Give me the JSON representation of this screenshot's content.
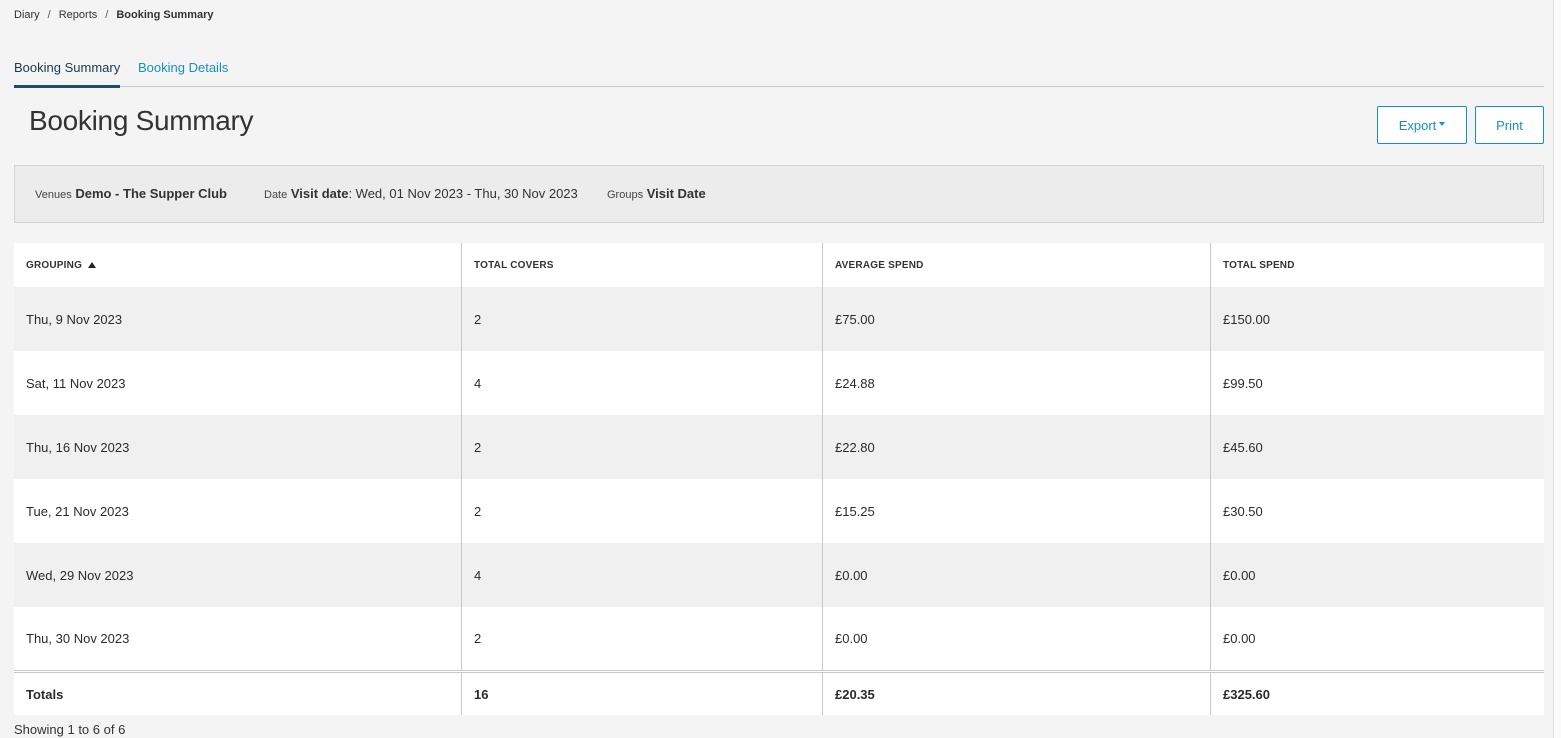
{
  "breadcrumb": {
    "items": [
      "Diary",
      "Reports"
    ],
    "separator": "/",
    "current": "Booking Summary"
  },
  "tabs": [
    {
      "label": "Booking Summary",
      "active": true
    },
    {
      "label": "Booking Details",
      "active": false
    }
  ],
  "page": {
    "title": "Booking Summary",
    "export_label": "Export",
    "print_label": "Print"
  },
  "filters": {
    "venues": {
      "label": "Venues",
      "value": "Demo - The Supper Club"
    },
    "date": {
      "label": "Date",
      "key": "Visit date",
      "value": ": Wed, 01 Nov 2023 - Thu, 30 Nov 2023"
    },
    "groups": {
      "label": "Groups",
      "value": "Visit Date"
    }
  },
  "table": {
    "columns": [
      "GROUPING",
      "TOTAL COVERS",
      "AVERAGE SPEND",
      "TOTAL SPEND"
    ],
    "sort": {
      "column": "GROUPING",
      "direction": "ascending"
    },
    "rows": [
      [
        "Thu, 9 Nov 2023",
        "2",
        "£75.00",
        "£150.00"
      ],
      [
        "Sat, 11 Nov 2023",
        "4",
        "£24.88",
        "£99.50"
      ],
      [
        "Thu, 16 Nov 2023",
        "2",
        "£22.80",
        "£45.60"
      ],
      [
        "Tue, 21 Nov 2023",
        "2",
        "£15.25",
        "£30.50"
      ],
      [
        "Wed, 29 Nov 2023",
        "4",
        "£0.00",
        "£0.00"
      ],
      [
        "Thu, 30 Nov 2023",
        "2",
        "£0.00",
        "£0.00"
      ]
    ],
    "totals": [
      "Totals",
      "16",
      "£20.35",
      "£325.60"
    ]
  },
  "footer": {
    "showing": "Showing 1 to 6 of 6"
  },
  "colors": {
    "accent": "#1a8fbf",
    "active_tab_underline": "#1f4e63",
    "page_background": "#f4f4f4"
  }
}
